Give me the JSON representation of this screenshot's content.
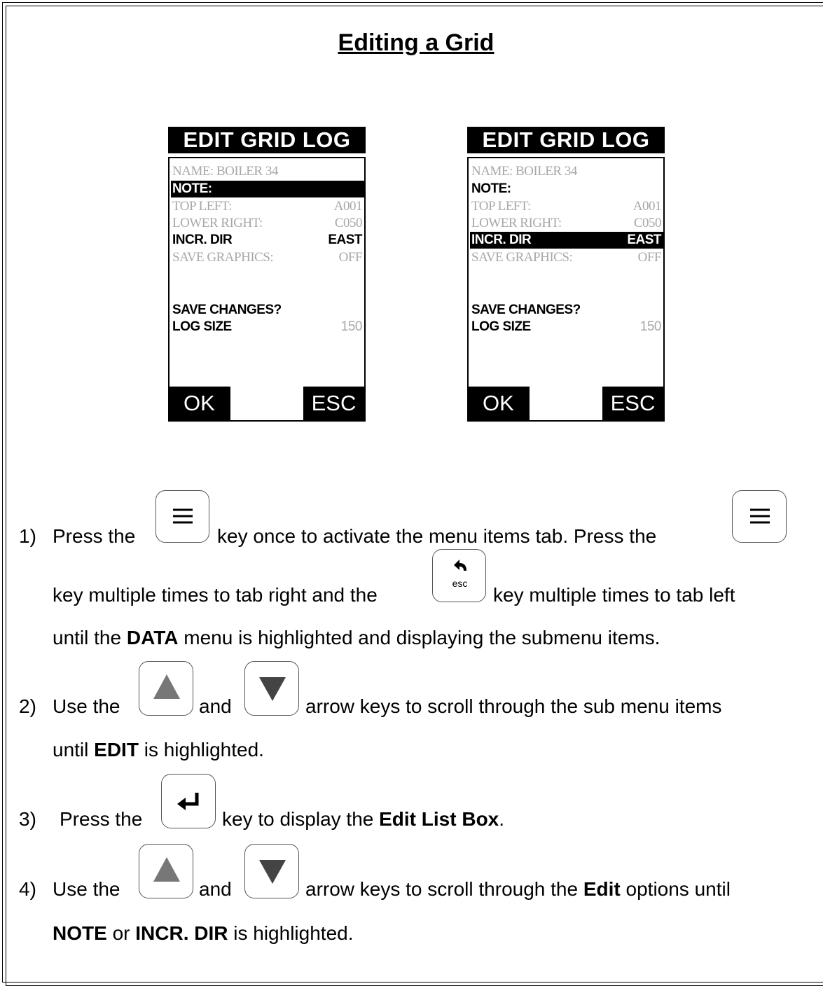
{
  "title": "Editing a Grid",
  "screens": [
    {
      "title": "EDIT GRID LOG",
      "rows": [
        {
          "label": "NAME: BOILER 34",
          "value": "",
          "state": "dim"
        },
        {
          "label": "NOTE:",
          "value": "",
          "state": "highlighted"
        },
        {
          "label": "TOP LEFT:",
          "value": "A001",
          "state": "dim"
        },
        {
          "label": "LOWER RIGHT:",
          "value": "C050",
          "state": "dim"
        },
        {
          "label": "INCR. DIR",
          "value": "EAST",
          "state": "active"
        },
        {
          "label": "SAVE GRAPHICS:",
          "value": "OFF",
          "state": "dim"
        },
        {
          "label": "SAVE CHANGES?",
          "value": "",
          "state": "active"
        },
        {
          "label": "LOG SIZE",
          "value": "150",
          "state": "active-dimvalue"
        }
      ],
      "softkeys": {
        "left": "OK",
        "right": "ESC"
      }
    },
    {
      "title": "EDIT GRID LOG",
      "rows": [
        {
          "label": "NAME: BOILER 34",
          "value": "",
          "state": "dim"
        },
        {
          "label": "NOTE:",
          "value": "",
          "state": "active"
        },
        {
          "label": "TOP LEFT:",
          "value": "A001",
          "state": "dim"
        },
        {
          "label": "LOWER RIGHT:",
          "value": "C050",
          "state": "dim"
        },
        {
          "label": "INCR. DIR",
          "value": "EAST",
          "state": "highlighted"
        },
        {
          "label": "SAVE GRAPHICS:",
          "value": "OFF",
          "state": "dim"
        },
        {
          "label": "SAVE CHANGES?",
          "value": "",
          "state": "active"
        },
        {
          "label": "LOG SIZE",
          "value": "150",
          "state": "active-dimvalue"
        }
      ],
      "softkeys": {
        "left": "OK",
        "right": "ESC"
      }
    }
  ],
  "steps": {
    "s1": {
      "num": "1)",
      "l1a": "Press the",
      "l1b": "key once to activate the menu items tab.  Press the",
      "l2a": "key multiple times to tab right and the",
      "l2b": "key multiple times to tab left",
      "l3a": "until the",
      "l3b": "DATA",
      "l3c": "menu is highlighted and displaying the submenu items."
    },
    "s2": {
      "num": "2)",
      "l1a": "Use the",
      "l1b": "and",
      "l1c": "arrow keys to scroll through the sub menu items",
      "l2a": "until",
      "l2b": "EDIT",
      "l2c": "is highlighted."
    },
    "s3": {
      "num": "3)",
      "l1a": "Press the",
      "l1b": "key to display the",
      "l1c": "Edit List Box",
      "l1d": "."
    },
    "s4": {
      "num": "4)",
      "l1a": "Use the",
      "l1b": "and",
      "l1c": "arrow keys to scroll through the",
      "l1d": "Edit",
      "l1e": "options until",
      "l2a": "NOTE",
      "l2b": "or",
      "l2c": "INCR. DIR",
      "l2d": "is highlighted."
    }
  },
  "keys": {
    "menu": "menu-icon",
    "esc": "esc",
    "up": "up-arrow-icon",
    "down": "down-arrow-icon",
    "enter": "enter-icon"
  }
}
